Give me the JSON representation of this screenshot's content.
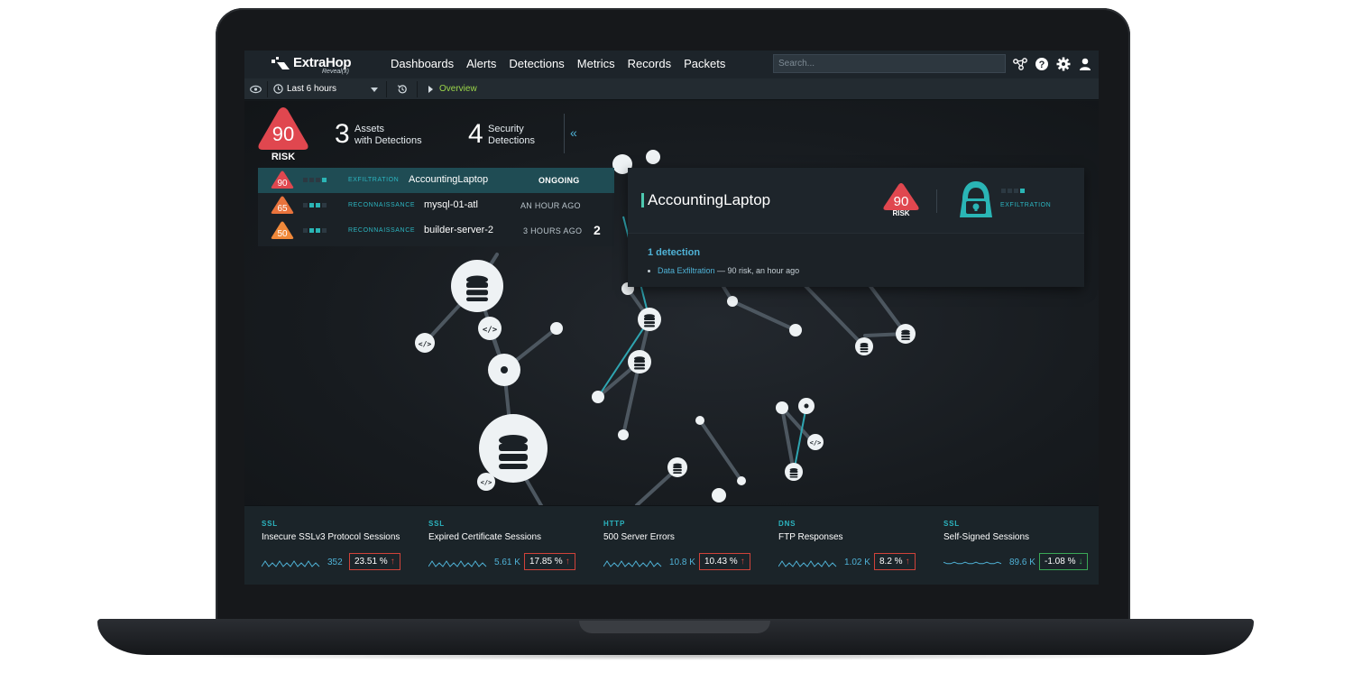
{
  "brand": {
    "name": "ExtraHop",
    "product": "Reveal(x)"
  },
  "nav": {
    "items": [
      "Dashboards",
      "Alerts",
      "Detections",
      "Metrics",
      "Records",
      "Packets"
    ]
  },
  "search": {
    "placeholder": "Search..."
  },
  "header_icons": [
    "network-icon",
    "help-icon",
    "gear-icon",
    "user-icon"
  ],
  "toolbar": {
    "time_range": "Last 6 hours",
    "breadcrumb": "Overview"
  },
  "summary": {
    "risk_score": "90",
    "risk_label": "RISK",
    "assets_count": "3",
    "assets_label_1": "Assets",
    "assets_label_2": "with Detections",
    "detections_count": "4",
    "detections_label_1": "Security",
    "detections_label_2": "Detections",
    "collapse_glyph": "«"
  },
  "detections": [
    {
      "score": "90",
      "level": 1,
      "category": "EXFILTRATION",
      "asset": "AccountingLaptop",
      "when": "ONGOING",
      "count": "",
      "color": "#e0474f"
    },
    {
      "score": "65",
      "level": 2,
      "category": "RECONNAISSANCE",
      "asset": "mysql-01-atl",
      "when": "AN HOUR AGO",
      "count": "",
      "color": "#e9733c"
    },
    {
      "score": "50",
      "level": 2,
      "category": "RECONNAISSANCE",
      "asset": "builder-server-2",
      "when": "3 HOURS AGO",
      "count": "2",
      "color": "#f0893a"
    }
  ],
  "detail": {
    "title": "AccountingLaptop",
    "risk_score": "90",
    "risk_label": "RISK",
    "category": "EXFILTRATION",
    "detection_count": "1 detection",
    "detection_link": "Data Exfiltration",
    "detection_meta": " — 90 risk, an hour ago"
  },
  "metrics": [
    {
      "proto": "SSL",
      "name": "Insecure SSLv3 Protocol Sessions",
      "value": "352",
      "pct": "23.51 %",
      "trend": "up"
    },
    {
      "proto": "SSL",
      "name": "Expired Certificate Sessions",
      "value": "5.61 K",
      "pct": "17.85 %",
      "trend": "up"
    },
    {
      "proto": "HTTP",
      "name": "500 Server Errors",
      "value": "10.8 K",
      "pct": "10.43 %",
      "trend": "up"
    },
    {
      "proto": "DNS",
      "name": "FTP Responses",
      "value": "1.02 K",
      "pct": "8.2 %",
      "trend": "up"
    },
    {
      "proto": "SSL",
      "name": "Self-Signed Sessions",
      "value": "89.6 K",
      "pct": "-1.08 %",
      "trend": "down"
    }
  ],
  "colors": {
    "accent": "#2cb5c0",
    "link": "#4fb2d6",
    "risk_high": "#e0474f",
    "breadcrumb": "#9bd64a"
  }
}
